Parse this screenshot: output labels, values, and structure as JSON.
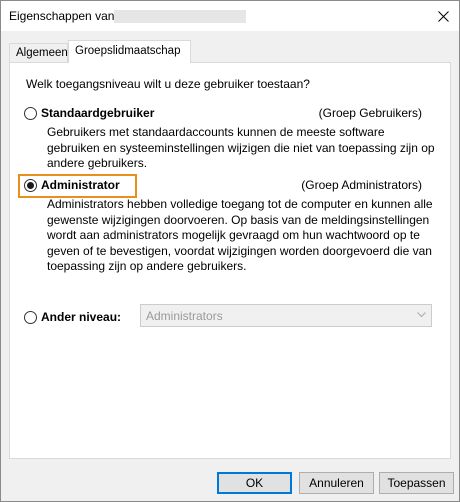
{
  "window": {
    "title": "Eigenschappen van"
  },
  "tabs": [
    {
      "label": "Algemeen"
    },
    {
      "label": "Groepslidmaatschap"
    }
  ],
  "question": "Welk toegangsniveau wilt u deze gebruiker toestaan?",
  "options": {
    "standard": {
      "label": "Standaardgebruiker",
      "group": "(Groep Gebruikers)",
      "description": "Gebruikers met standaardaccounts kunnen de meeste software gebruiken en systeeminstellingen wijzigen die niet van toepassing zijn op andere gebruikers.",
      "checked": false
    },
    "admin": {
      "label": "Administrator",
      "group": "(Groep Administrators)",
      "description": "Administrators hebben volledige toegang tot de computer en kunnen alle gewenste wijzigingen doorvoeren. Op basis van de meldingsinstellingen wordt aan administrators mogelijk gevraagd om hun wachtwoord op te geven of te bevestigen, voordat wijzigingen worden doorgevoerd die van toepassing zijn op andere gebruikers.",
      "checked": true
    },
    "other": {
      "label": "Ander niveau:",
      "select_value": "Administrators",
      "checked": false
    }
  },
  "buttons": {
    "ok": "OK",
    "cancel": "Annuleren",
    "apply": "Toepassen"
  },
  "colors": {
    "highlight": "#e8901c",
    "default_button_border": "#0078d7"
  },
  "icons": {
    "close": "close-icon",
    "dropdown": "chevron-down-icon"
  }
}
